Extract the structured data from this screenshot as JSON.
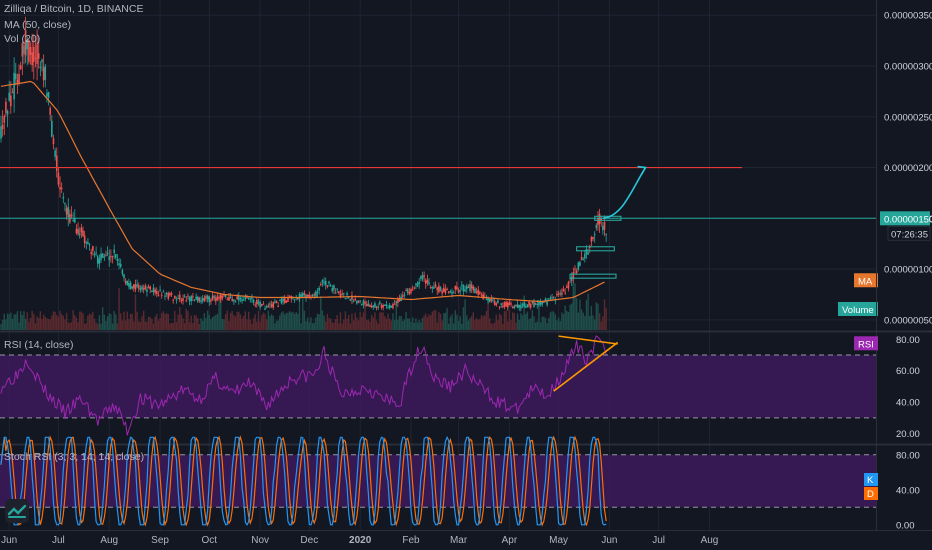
{
  "legend": {
    "symbol": "Zilliqa / Bitcoin, 1D, BINANCE",
    "ma": "MA (50, close)",
    "vol": "Vol (20)",
    "rsi": "RSI (14, close)",
    "stoch": "Stoch RSI (3, 3, 14, 14, close)"
  },
  "colors": {
    "background": "#131722",
    "grid": "#1f2433",
    "up": "#26a69a",
    "down": "#ef5350",
    "ma": "#e8772e",
    "resistance": "#e53935",
    "support": "#26a69a",
    "rsi_line": "#9c27b0",
    "rsi_band": "#3d1a5c",
    "stoch_k": "#2196f3",
    "stoch_d": "#ff6d00",
    "annotation_arrow": "#26c6da",
    "triangle": "#ff9800",
    "axis_text": "#b2b5be"
  },
  "badges": {
    "price": "0.00000150",
    "countdown": "07:26:35",
    "ma": "MA",
    "volume": "Volume",
    "rsi": "RSI",
    "k": "K",
    "d": "D"
  },
  "chart_data": [
    {
      "type": "candlestick",
      "title": "Zilliqa / Bitcoin, 1D, BINANCE",
      "x": [
        "Jun",
        "Jul",
        "Aug",
        "Sep",
        "Oct",
        "Nov",
        "Dec",
        "2020",
        "Feb",
        "Mar",
        "Apr",
        "May",
        "Jun",
        "Jul",
        "Aug"
      ],
      "y_ticks": [
        "0.00000050",
        "0.00000100",
        "0.00000150",
        "0.00000200",
        "0.00000250",
        "0.00000300",
        "0.00000350"
      ],
      "ylim": [
        4e-07,
        3.65e-06
      ],
      "close_path": [
        {
          "date": "2019-05-27",
          "close": 2.4e-06
        },
        {
          "date": "2019-06-06",
          "close": 2.9e-06
        },
        {
          "date": "2019-06-11",
          "close": 3.2e-06
        },
        {
          "date": "2019-06-22",
          "close": 3e-06
        },
        {
          "date": "2019-07-01",
          "close": 1.9e-06
        },
        {
          "date": "2019-07-08",
          "close": 1.5e-06
        },
        {
          "date": "2019-07-15",
          "close": 1.35e-06
        },
        {
          "date": "2019-07-25",
          "close": 1.1e-06
        },
        {
          "date": "2019-08-05",
          "close": 1.15e-06
        },
        {
          "date": "2019-08-12",
          "close": 8.5e-07
        },
        {
          "date": "2019-08-25",
          "close": 8e-07
        },
        {
          "date": "2019-09-10",
          "close": 7.2e-07
        },
        {
          "date": "2019-09-25",
          "close": 7e-07
        },
        {
          "date": "2019-10-10",
          "close": 7.2e-07
        },
        {
          "date": "2019-10-25",
          "close": 7e-07
        },
        {
          "date": "2019-11-05",
          "close": 6.2e-07
        },
        {
          "date": "2019-11-20",
          "close": 7.2e-07
        },
        {
          "date": "2019-12-05",
          "close": 7.5e-07
        },
        {
          "date": "2019-12-10",
          "close": 8.8e-07
        },
        {
          "date": "2019-12-20",
          "close": 7.5e-07
        },
        {
          "date": "2020-01-05",
          "close": 6.6e-07
        },
        {
          "date": "2020-01-20",
          "close": 6.3e-07
        },
        {
          "date": "2020-02-01",
          "close": 8e-07
        },
        {
          "date": "2020-02-08",
          "close": 9.2e-07
        },
        {
          "date": "2020-02-20",
          "close": 7.8e-07
        },
        {
          "date": "2020-03-08",
          "close": 8.2e-07
        },
        {
          "date": "2020-03-20",
          "close": 6.8e-07
        },
        {
          "date": "2020-04-05",
          "close": 6.3e-07
        },
        {
          "date": "2020-04-25",
          "close": 6.8e-07
        },
        {
          "date": "2020-05-05",
          "close": 7.8e-07
        },
        {
          "date": "2020-05-12",
          "close": 1e-06
        },
        {
          "date": "2020-05-20",
          "close": 1.2e-06
        },
        {
          "date": "2020-05-25",
          "close": 1.5e-06
        },
        {
          "date": "2020-05-30",
          "close": 1.4e-06
        }
      ],
      "ma_path": [
        {
          "date": "2019-05-27",
          "ma": 2.8e-06
        },
        {
          "date": "2019-06-15",
          "ma": 2.85e-06
        },
        {
          "date": "2019-07-01",
          "ma": 2.55e-06
        },
        {
          "date": "2019-07-15",
          "ma": 2.1e-06
        },
        {
          "date": "2019-08-01",
          "ma": 1.6e-06
        },
        {
          "date": "2019-08-15",
          "ma": 1.2e-06
        },
        {
          "date": "2019-09-01",
          "ma": 9.5e-07
        },
        {
          "date": "2019-09-20",
          "ma": 8.2e-07
        },
        {
          "date": "2019-10-10",
          "ma": 7.5e-07
        },
        {
          "date": "2019-11-01",
          "ma": 7.2e-07
        },
        {
          "date": "2019-12-01",
          "ma": 7.2e-07
        },
        {
          "date": "2020-01-01",
          "ma": 7.3e-07
        },
        {
          "date": "2020-02-01",
          "ma": 7e-07
        },
        {
          "date": "2020-03-01",
          "ma": 7.4e-07
        },
        {
          "date": "2020-04-01",
          "ma": 7e-07
        },
        {
          "date": "2020-04-20",
          "ma": 6.8e-07
        },
        {
          "date": "2020-05-10",
          "ma": 7.2e-07
        },
        {
          "date": "2020-05-30",
          "ma": 8.8e-07
        }
      ],
      "levels": {
        "resistance": 2e-06,
        "current": 1.5e-06
      },
      "boxes": [
        {
          "from": "2020-05-23",
          "to": "2020-06-08",
          "price": 1.5e-06
        },
        {
          "from": "2020-05-12",
          "to": "2020-06-04",
          "price": 1.2e-06
        },
        {
          "from": "2020-05-08",
          "to": "2020-06-05",
          "price": 9.3e-07
        }
      ],
      "arrow": {
        "from_date": "2020-05-28",
        "from_price": 1.5e-06,
        "to_date": "2020-06-23",
        "to_price": 2e-06
      }
    },
    {
      "type": "line",
      "title": "RSI (14, close)",
      "y_ticks": [
        "20.00",
        "40.00",
        "60.00",
        "80.00"
      ],
      "ylim": [
        14,
        84
      ],
      "bands": [
        30,
        70
      ],
      "trend_lines": [
        {
          "from_date": "2020-05-01",
          "from_value": 82,
          "to_date": "2020-06-06",
          "to_value": 77
        },
        {
          "from_date": "2020-04-28",
          "from_value": 47,
          "to_date": "2020-06-06",
          "to_value": 78
        }
      ],
      "series": [
        {
          "color_key": "rsi_line",
          "points": [
            {
              "date": "2019-05-27",
              "value": 50
            },
            {
              "date": "2019-06-06",
              "value": 58
            },
            {
              "date": "2019-06-12",
              "value": 68
            },
            {
              "date": "2019-06-22",
              "value": 48
            },
            {
              "date": "2019-07-05",
              "value": 33
            },
            {
              "date": "2019-07-15",
              "value": 42
            },
            {
              "date": "2019-07-25",
              "value": 28
            },
            {
              "date": "2019-08-05",
              "value": 38
            },
            {
              "date": "2019-08-12",
              "value": 22
            },
            {
              "date": "2019-08-20",
              "value": 42
            },
            {
              "date": "2019-09-01",
              "value": 38
            },
            {
              "date": "2019-09-15",
              "value": 48
            },
            {
              "date": "2019-09-25",
              "value": 42
            },
            {
              "date": "2019-10-05",
              "value": 55
            },
            {
              "date": "2019-10-15",
              "value": 45
            },
            {
              "date": "2019-10-25",
              "value": 52
            },
            {
              "date": "2019-11-05",
              "value": 38
            },
            {
              "date": "2019-11-20",
              "value": 55
            },
            {
              "date": "2019-12-05",
              "value": 58
            },
            {
              "date": "2019-12-10",
              "value": 72
            },
            {
              "date": "2019-12-20",
              "value": 45
            },
            {
              "date": "2020-01-05",
              "value": 50
            },
            {
              "date": "2020-01-15",
              "value": 42
            },
            {
              "date": "2020-01-25",
              "value": 38
            },
            {
              "date": "2020-02-02",
              "value": 65
            },
            {
              "date": "2020-02-08",
              "value": 77
            },
            {
              "date": "2020-02-15",
              "value": 55
            },
            {
              "date": "2020-02-25",
              "value": 50
            },
            {
              "date": "2020-03-05",
              "value": 60
            },
            {
              "date": "2020-03-12",
              "value": 52
            },
            {
              "date": "2020-03-25",
              "value": 40
            },
            {
              "date": "2020-04-05",
              "value": 35
            },
            {
              "date": "2020-04-15",
              "value": 48
            },
            {
              "date": "2020-04-25",
              "value": 45
            },
            {
              "date": "2020-05-05",
              "value": 62
            },
            {
              "date": "2020-05-12",
              "value": 75
            },
            {
              "date": "2020-05-18",
              "value": 68
            },
            {
              "date": "2020-05-25",
              "value": 80
            },
            {
              "date": "2020-05-30",
              "value": 70
            }
          ]
        }
      ]
    },
    {
      "type": "line",
      "title": "Stoch RSI (3, 3, 14, 14, close)",
      "y_ticks": [
        "0.00",
        "40.00",
        "80.00"
      ],
      "ylim": [
        -6,
        90
      ],
      "bands": [
        20,
        80
      ],
      "series": [
        {
          "name": "K",
          "color_key": "stoch_k",
          "cycle_days": 13
        },
        {
          "name": "D",
          "color_key": "stoch_d",
          "cycle_days": 13
        }
      ]
    }
  ],
  "x_labels": [
    "Jun",
    "Jul",
    "Aug",
    "Sep",
    "Oct",
    "Nov",
    "Dec",
    "2020",
    "Feb",
    "Mar",
    "Apr",
    "May",
    "Jun",
    "Jul",
    "Aug"
  ],
  "x_label_dates": [
    "2019-06-01",
    "2019-07-01",
    "2019-08-01",
    "2019-09-01",
    "2019-10-01",
    "2019-11-01",
    "2019-12-01",
    "2020-01-01",
    "2020-02-01",
    "2020-03-01",
    "2020-04-01",
    "2020-05-01",
    "2020-06-01",
    "2020-07-01",
    "2020-08-01"
  ]
}
